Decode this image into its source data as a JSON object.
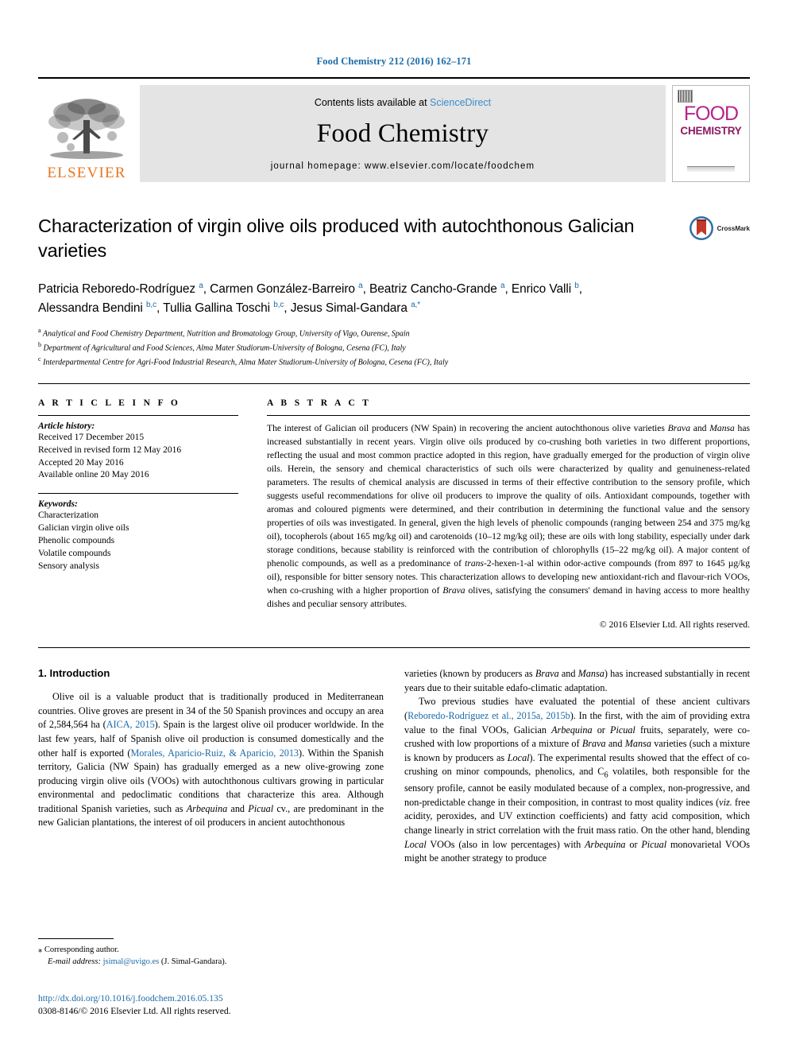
{
  "running_head": "Food Chemistry 212 (2016) 162–171",
  "masthead": {
    "contents_prefix": "Contents lists available at ",
    "sciencedirect": "ScienceDirect",
    "journal_title": "Food Chemistry",
    "homepage": "journal homepage: www.elsevier.com/locate/foodchem",
    "publisher": "ELSEVIER",
    "cover": {
      "line1": "FOOD",
      "line2": "CHEMISTRY"
    },
    "accent_link_color": "#3c8ccb",
    "publisher_color": "#e87722",
    "cover_color": "#b6248b"
  },
  "article": {
    "title": "Characterization of virgin olive oils produced with autochthonous Galician varieties",
    "crossmark_label": "CrossMark",
    "authors_line1": "Patricia Reboredo-Rodríguez <sup>a</sup>, Carmen González-Barreiro <sup>a</sup>, Beatriz Cancho-Grande <sup>a</sup>, Enrico Valli <sup>b</sup>,",
    "authors_line2": "Alessandra Bendini <sup>b,c</sup>, Tullia Gallina Toschi <sup>b,c</sup>, Jesus Simal-Gandara <sup>a,*</sup>",
    "affiliations": [
      "<sup>a</sup> Analytical and Food Chemistry Department, Nutrition and Bromatology Group, University of Vigo, Ourense, Spain",
      "<sup>b</sup> Department of Agricultural and Food Sciences, Alma Mater Studiorum-University of Bologna, Cesena (FC), Italy",
      "<sup>c</sup> Interdepartmental Centre for Agri-Food Industrial Research, Alma Mater Studiorum-University of Bologna, Cesena (FC), Italy"
    ]
  },
  "article_info": {
    "heading": "A R T I C L E   I N F O",
    "history_label": "Article history:",
    "history": [
      "Received 17 December 2015",
      "Received in revised form 12 May 2016",
      "Accepted 20 May 2016",
      "Available online 20 May 2016"
    ],
    "keywords_label": "Keywords:",
    "keywords": [
      "Characterization",
      "Galician virgin olive oils",
      "Phenolic compounds",
      "Volatile compounds",
      "Sensory analysis"
    ]
  },
  "abstract": {
    "heading": "A B S T R A C T",
    "body": "The interest of Galician oil producers (NW Spain) in recovering the ancient autochthonous olive varieties <i>Brava</i> and <i>Mansa</i> has increased substantially in recent years. Virgin olive oils produced by co-crushing both varieties in two different proportions, reflecting the usual and most common practice adopted in this region, have gradually emerged for the production of virgin olive oils. Herein, the sensory and chemical characteristics of such oils were characterized by quality and genuineness-related parameters. The results of chemical analysis are discussed in terms of their effective contribution to the sensory profile, which suggests useful recommendations for olive oil producers to improve the quality of oils. Antioxidant compounds, together with aromas and coloured pigments were determined, and their contribution in determining the functional value and the sensory properties of oils was investigated. In general, given the high levels of phenolic compounds (ranging between 254 and 375 mg/kg oil), tocopherols (about 165 mg/kg oil) and carotenoids (10–12 mg/kg oil); these are oils with long stability, especially under dark storage conditions, because stability is reinforced with the contribution of chlorophylls (15–22 mg/kg oil). A major content of phenolic compounds, as well as a predominance of <i>trans</i>-2-hexen-1-al within odor-active compounds (from 897 to 1645 µg/kg oil), responsible for bitter sensory notes. This characterization allows to developing new antioxidant-rich and flavour-rich VOOs, when co-crushing with a higher proportion of <i>Brava</i> olives, satisfying the consumers' demand in having access to more healthy dishes and peculiar sensory attributes.",
    "copyright": "© 2016 Elsevier Ltd. All rights reserved."
  },
  "introduction": {
    "heading": "1. Introduction",
    "left_paragraph": "Olive oil is a valuable product that is traditionally produced in Mediterranean countries. Olive groves are present in 34 of the 50 Spanish provinces and occupy an area of 2,584,564 ha (<span class=\"ref\">AICA, 2015</span>). Spain is the largest olive oil producer worldwide. In the last few years, half of Spanish olive oil production is consumed domestically and the other half is exported (<span class=\"ref\">Morales, Aparicio-Ruiz, &amp; Aparicio, 2013</span>). Within the Spanish territory, Galicia (NW Spain) has gradually emerged as a new olive-growing zone producing virgin olive oils (VOOs) with autochthonous cultivars growing in particular environmental and pedoclimatic conditions that characterize this area. Although traditional Spanish varieties, such as <i>Arbequina</i> and <i>Picual</i> cv., are predominant in the new Galician plantations, the interest of oil producers in ancient autochthonous",
    "right_paragraph_1": "varieties (known by producers as <i>Brava</i> and <i>Mansa</i>) has increased substantially in recent years due to their suitable edafo-climatic adaptation.",
    "right_paragraph_2": "Two previous studies have evaluated the potential of these ancient cultivars (<span class=\"ref\">Reboredo-Rodríguez et al., 2015a, 2015b</span>). In the first, with the aim of providing extra value to the final VOOs, Galician <i>Arbequina</i> or <i>Picual</i> fruits, separately, were co-crushed with low proportions of a mixture of <i>Brava</i> and <i>Mansa</i> varieties (such a mixture is known by producers as <i>Local</i>). The experimental results showed that the effect of co-crushing on minor compounds, phenolics, and C<sub>6</sub> volatiles, both responsible for the sensory profile, cannot be easily modulated because of a complex, non-progressive, and non-predictable change in their composition, in contrast to most quality indices (<i>viz.</i> free acidity, peroxides, and UV extinction coefficients) and fatty acid composition, which change linearly in strict correlation with the fruit mass ratio. On the other hand, blending <i>Local</i> VOOs (also in low percentages) with <i>Arbequina</i> or <i>Picual</i> monovarietal VOOs might be another strategy to produce"
  },
  "footnote": {
    "corresponding": "<span class=\"star\">⁎</span> Corresponding author.",
    "email_label": "E-mail address:",
    "email": "jsimal@uvigo.es",
    "email_owner": "(J. Simal-Gandara).",
    "doi": "http://dx.doi.org/10.1016/j.foodchem.2016.05.135",
    "issn": "0308-8146/© 2016 Elsevier Ltd. All rights reserved."
  }
}
